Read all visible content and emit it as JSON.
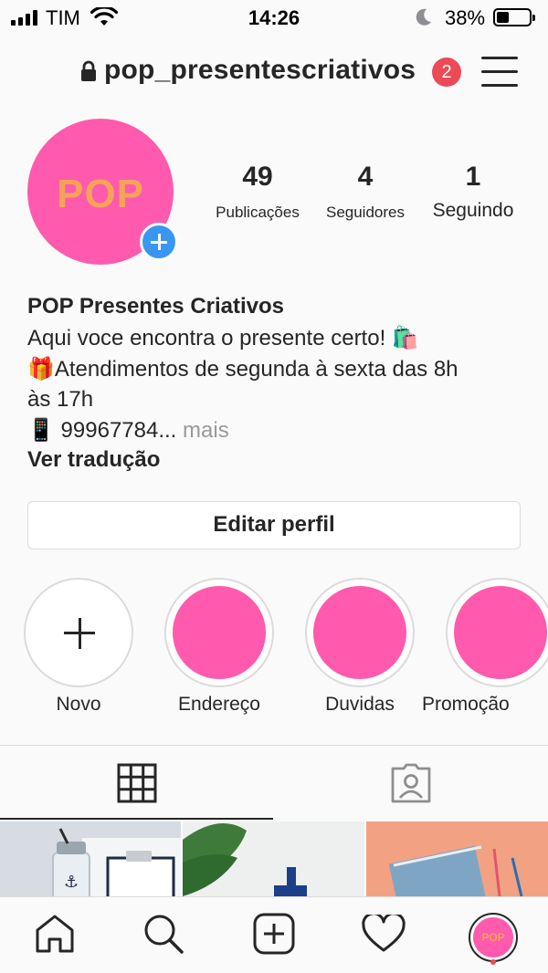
{
  "status_bar": {
    "carrier": "TIM",
    "time": "14:26",
    "battery_percent": "38%",
    "battery_level": 0.38
  },
  "header": {
    "username": "pop_presentescriativos",
    "notification_count": "2",
    "icons": [
      "lock-icon",
      "menu-icon"
    ]
  },
  "profile": {
    "avatar_text": "POP",
    "stats": [
      {
        "value": "49",
        "label": "Publicações"
      },
      {
        "value": "4",
        "label": "Seguidores"
      },
      {
        "value": "1",
        "label": "Seguindo"
      }
    ],
    "name": "POP Presentes Criativos",
    "bio_lines": [
      "Aqui voce encontra o presente certo! 🛍️",
      "🎁Atendimentos de segunda à sexta das 8h",
      "às 17h",
      "📱 99967784..."
    ],
    "more_label": "mais",
    "translate_label": "Ver tradução"
  },
  "edit_profile_label": "Editar perfil",
  "highlights": [
    {
      "label": "Novo"
    },
    {
      "label": "Endereço"
    },
    {
      "label": "Duvidas"
    },
    {
      "label": "Promoção"
    }
  ],
  "tabs": [
    "grid-icon",
    "tagged-icon"
  ],
  "colors": {
    "brand_pink": "#ff5aad",
    "logo_orange": "#f6a35a",
    "notification_red": "#ed4956",
    "add_blue": "#3897f0"
  },
  "bottom_nav": [
    "home-icon",
    "search-icon",
    "add-post-icon",
    "heart-icon",
    "profile-avatar"
  ],
  "nav_avatar_text": "POP"
}
